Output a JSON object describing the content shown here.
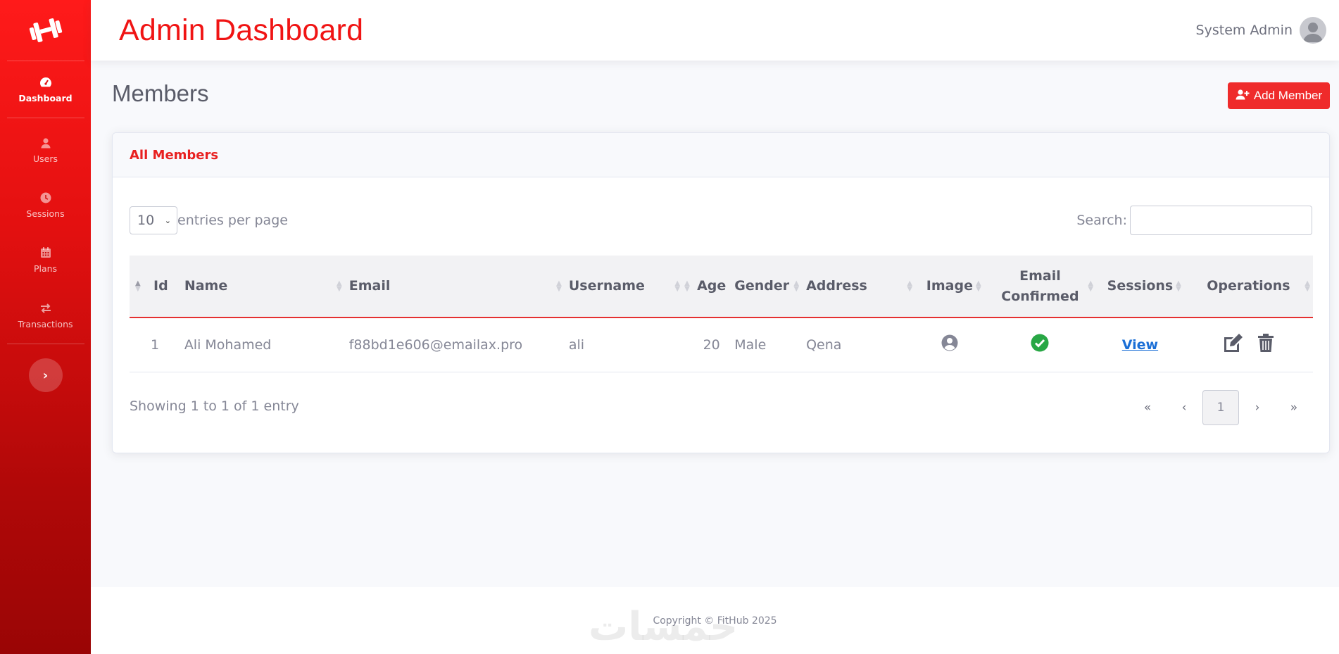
{
  "topbar": {
    "title": "Admin Dashboard",
    "user_name": "System Admin"
  },
  "sidebar": {
    "items": [
      {
        "label": "Dashboard",
        "icon": "gauge-icon",
        "active": true
      },
      {
        "label": "Users",
        "icon": "user-icon"
      },
      {
        "label": "Sessions",
        "icon": "clock-icon"
      },
      {
        "label": "Plans",
        "icon": "calendar-icon"
      },
      {
        "label": "Transactions",
        "icon": "exchange-icon"
      }
    ]
  },
  "page": {
    "title": "Members",
    "add_button": "Add Member"
  },
  "card": {
    "title": "All Members",
    "entries_value": "10",
    "entries_label": "entries per page",
    "search_label": "Search:",
    "search_placeholder": "",
    "columns": [
      "Id",
      "Name",
      "Email",
      "Username",
      "Age",
      "Gender",
      "Address",
      "Image",
      "Email\nConfirmed",
      "Sessions",
      "Operations"
    ],
    "rows": [
      {
        "id": "1",
        "name": "Ali Mohamed",
        "email": "f88bd1e606@emailax.pro",
        "username": "ali",
        "age": "20",
        "gender": "Male",
        "address": "Qena",
        "sessions_link": "View"
      }
    ],
    "info": "Showing 1 to 1 of 1 entry",
    "pagination": {
      "first": "«",
      "prev": "‹",
      "current": "1",
      "next": "›",
      "last": "»"
    }
  },
  "footer": {
    "text": "Copyright © FitHub 2025"
  },
  "watermark": "خمسات",
  "colors": {
    "accent": "#ef2b2b",
    "sidebar_top": "#ff1a1a",
    "sidebar_bottom": "#9a0505",
    "link": "#1b6fd6",
    "confirmed": "#28a745"
  }
}
